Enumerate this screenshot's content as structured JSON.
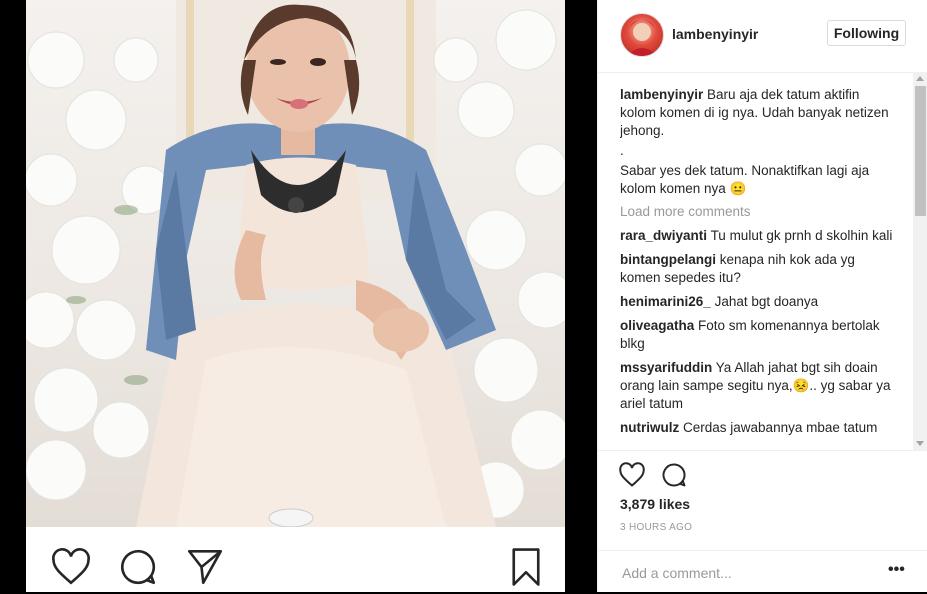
{
  "post": {
    "username": "lambenyinyir",
    "follow_label": "Following",
    "caption_user": "lambenyinyir",
    "caption_lines": [
      "Baru aja dek tatum aktifin kolom komen di ig nya. Udah banyak netizen jehong.",
      ".",
      "Sabar yes dek tatum. Nonaktifkan lagi aja kolom komen nya 😐"
    ],
    "load_more": "Load more comments",
    "comments": [
      {
        "user": "rara_dwiyanti",
        "text": "Tu mulut gk prnh d skolhin kali"
      },
      {
        "user": "bintangpelangi",
        "text": "kenapa nih kok ada yg komen sepedes itu?"
      },
      {
        "user": "henimarini26_",
        "text": "Jahat bgt doanya"
      },
      {
        "user": "oliveagatha",
        "text": "Foto sm komenannya bertolak blkg"
      },
      {
        "user": "mssyarifuddin",
        "text": "Ya Allah jahat bgt sih doain orang lain sampe segitu nya,😣.. yg sabar ya ariel tatum"
      },
      {
        "user": "nutriwulz",
        "text": "Cerdas jawabannya mbae tatum"
      }
    ],
    "likes": "3,879 likes",
    "time": "3 HOURS AGO",
    "comment_placeholder": "Add a comment...",
    "more_label": "•••"
  },
  "colors": {
    "text": "#262626",
    "muted": "#999999",
    "border": "#efefef"
  },
  "icons": {
    "photo_bar": [
      "heart-icon",
      "comment-icon",
      "send-icon",
      "bookmark-icon"
    ],
    "panel_bar": [
      "heart-icon",
      "comment-icon"
    ]
  }
}
